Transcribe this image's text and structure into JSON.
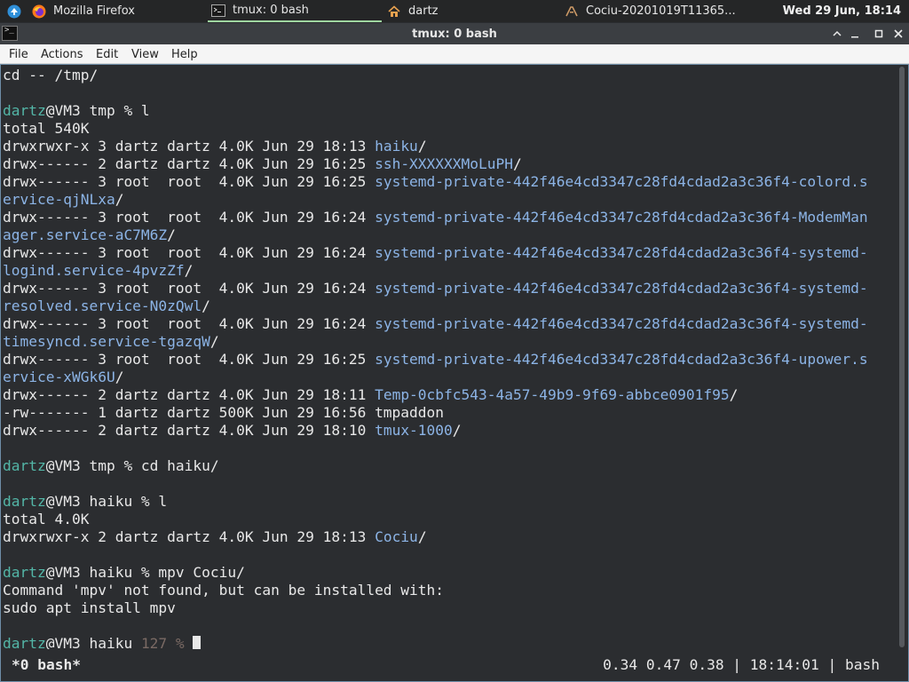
{
  "taskbar": {
    "items": [
      {
        "label": "Mozilla Firefox",
        "icon": "firefox-icon"
      },
      {
        "label": "tmux: 0 bash",
        "icon": "terminal-icon",
        "active": true
      },
      {
        "label": "dartz",
        "icon": "home-folder-icon"
      },
      {
        "label": "Cociu-20201019T11365...",
        "icon": "media-icon"
      }
    ],
    "clock": "Wed 29 Jun, 18:14"
  },
  "window": {
    "title": "tmux: 0 bash",
    "menu": [
      "File",
      "Actions",
      "Edit",
      "View",
      "Help"
    ]
  },
  "terminal": {
    "lines": [
      [
        {
          "t": "cd -- /tmp/"
        }
      ],
      [],
      [
        {
          "t": "dartz",
          "c": "u"
        },
        {
          "t": "@VM3 tmp % l"
        }
      ],
      [
        {
          "t": "total 540K"
        }
      ],
      [
        {
          "t": "drwxrwxr-x 3 dartz dartz 4.0K Jun 29 18:13 "
        },
        {
          "t": "haiku",
          "c": "d"
        },
        {
          "t": "/"
        }
      ],
      [
        {
          "t": "drwx------ 2 dartz dartz 4.0K Jun 29 16:25 "
        },
        {
          "t": "ssh-XXXXXXMoLuPH",
          "c": "d"
        },
        {
          "t": "/"
        }
      ],
      [
        {
          "t": "drwx------ 3 root  root  4.0K Jun 29 16:25 "
        },
        {
          "t": "systemd-private-442f46e4cd3347c28fd4cdad2a3c36f4-colord.s",
          "c": "d"
        }
      ],
      [
        {
          "t": "ervice-qjNLxa",
          "c": "d"
        },
        {
          "t": "/"
        }
      ],
      [
        {
          "t": "drwx------ 3 root  root  4.0K Jun 29 16:24 "
        },
        {
          "t": "systemd-private-442f46e4cd3347c28fd4cdad2a3c36f4-ModemMan",
          "c": "d"
        }
      ],
      [
        {
          "t": "ager.service-aC7M6Z",
          "c": "d"
        },
        {
          "t": "/"
        }
      ],
      [
        {
          "t": "drwx------ 3 root  root  4.0K Jun 29 16:24 "
        },
        {
          "t": "systemd-private-442f46e4cd3347c28fd4cdad2a3c36f4-systemd-",
          "c": "d"
        }
      ],
      [
        {
          "t": "logind.service-4pvzZf",
          "c": "d"
        },
        {
          "t": "/"
        }
      ],
      [
        {
          "t": "drwx------ 3 root  root  4.0K Jun 29 16:24 "
        },
        {
          "t": "systemd-private-442f46e4cd3347c28fd4cdad2a3c36f4-systemd-",
          "c": "d"
        }
      ],
      [
        {
          "t": "resolved.service-N0zQwl",
          "c": "d"
        },
        {
          "t": "/"
        }
      ],
      [
        {
          "t": "drwx------ 3 root  root  4.0K Jun 29 16:24 "
        },
        {
          "t": "systemd-private-442f46e4cd3347c28fd4cdad2a3c36f4-systemd-",
          "c": "d"
        }
      ],
      [
        {
          "t": "timesyncd.service-tgazqW",
          "c": "d"
        },
        {
          "t": "/"
        }
      ],
      [
        {
          "t": "drwx------ 3 root  root  4.0K Jun 29 16:25 "
        },
        {
          "t": "systemd-private-442f46e4cd3347c28fd4cdad2a3c36f4-upower.s",
          "c": "d"
        }
      ],
      [
        {
          "t": "ervice-xWGk6U",
          "c": "d"
        },
        {
          "t": "/"
        }
      ],
      [
        {
          "t": "drwx------ 2 dartz dartz 4.0K Jun 29 18:11 "
        },
        {
          "t": "Temp-0cbfc543-4a57-49b9-9f69-abbce0901f95",
          "c": "d"
        },
        {
          "t": "/"
        }
      ],
      [
        {
          "t": "-rw------- 1 dartz dartz 500K Jun 29 16:56 tmpaddon"
        }
      ],
      [
        {
          "t": "drwx------ 2 dartz dartz 4.0K Jun 29 18:10 "
        },
        {
          "t": "tmux-1000",
          "c": "d"
        },
        {
          "t": "/"
        }
      ],
      [],
      [
        {
          "t": "dartz",
          "c": "u"
        },
        {
          "t": "@VM3 tmp % cd haiku/"
        }
      ],
      [],
      [
        {
          "t": "dartz",
          "c": "u"
        },
        {
          "t": "@VM3 haiku % l"
        }
      ],
      [
        {
          "t": "total 4.0K"
        }
      ],
      [
        {
          "t": "drwxrwxr-x 2 dartz dartz 4.0K Jun 29 18:13 "
        },
        {
          "t": "Cociu",
          "c": "d"
        },
        {
          "t": "/"
        }
      ],
      [],
      [
        {
          "t": "dartz",
          "c": "u"
        },
        {
          "t": "@VM3 haiku % mpv Cociu/"
        }
      ],
      [
        {
          "t": "Command 'mpv' not found, but can be installed with:"
        }
      ],
      [
        {
          "t": "sudo apt install mpv"
        }
      ],
      [],
      [
        {
          "t": "dartz",
          "c": "u"
        },
        {
          "t": "@VM3 haiku "
        },
        {
          "t": "127 %",
          "c": "g"
        },
        {
          "t": " "
        },
        {
          "cursor": true
        }
      ]
    ]
  },
  "status": {
    "window": "*0 bash*",
    "right": "0.34 0.47 0.38 | 18:14:01 | bash"
  },
  "colors": {
    "user": "#53b6a7",
    "directory": "#8cb4e6",
    "exit_code": "#7a6a64",
    "background": "#2b2d30"
  }
}
